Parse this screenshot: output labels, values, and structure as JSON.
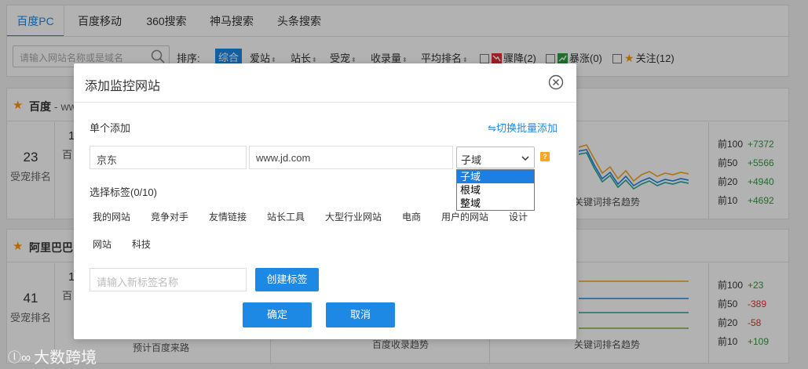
{
  "tabs": [
    {
      "label": "百度PC",
      "active": true
    },
    {
      "label": "百度移动"
    },
    {
      "label": "360搜索"
    },
    {
      "label": "神马搜索"
    },
    {
      "label": "头条搜索"
    }
  ],
  "filter": {
    "search_placeholder": "请输入网站名称或是域名",
    "sort_label": "排序:",
    "sort_items": [
      "综合",
      "爱站",
      "站长",
      "受宠",
      "收录量",
      "平均排名"
    ],
    "check_drop": "骤降(2)",
    "check_rise": "暴涨(0)",
    "check_follow": "关注(12)"
  },
  "cards": [
    {
      "name": "百度",
      "domain_fragment": "- ww",
      "rank": "23",
      "rank_label": "受宠排名",
      "col2_num": "1",
      "col2_txt": "百",
      "chart_caption": "关键词排名趋势",
      "stats": [
        {
          "k": "前100",
          "v": "+7372",
          "dir": "up"
        },
        {
          "k": "前50",
          "v": "+5566",
          "dir": "up"
        },
        {
          "k": "前20",
          "v": "+4940",
          "dir": "up"
        },
        {
          "k": "前10",
          "v": "+4692",
          "dir": "up"
        }
      ]
    },
    {
      "name": "阿里巴巴",
      "rank": "41",
      "rank_label": "受宠排名",
      "col2_num": "1",
      "col2_txt": "百",
      "caption_a": "预计百度来路",
      "caption_b": "百度收录趋势",
      "chart_caption": "关键词排名趋势",
      "stats": [
        {
          "k": "前100",
          "v": "+23",
          "dir": "up"
        },
        {
          "k": "前50",
          "v": "-389",
          "dir": "down"
        },
        {
          "k": "前20",
          "v": "-58",
          "dir": "down"
        },
        {
          "k": "前10",
          "v": "+109",
          "dir": "up"
        }
      ]
    }
  ],
  "modal": {
    "title": "添加监控网站",
    "single_add": "单个添加",
    "switch_link": "⇋切换批量添加",
    "name_value": "京东",
    "domain_value": "www.jd.com",
    "select_value": "子域",
    "select_options": [
      "子域",
      "根域",
      "整域"
    ],
    "tags_label": "选择标签(0/10)",
    "tags": [
      "我的网站",
      "竞争对手",
      "友情链接",
      "站长工具",
      "大型行业网站",
      "电商",
      "用户的网站",
      "设计",
      "网站",
      "科技"
    ],
    "new_tag_placeholder": "请输入新标签名称",
    "create_tag_button": "创建标签",
    "confirm_button": "确定",
    "cancel_button": "取消"
  },
  "watermark": "大数跨境",
  "colors": {
    "accent": "#1e88e5",
    "rise": "#2e9e3e",
    "fall": "#e03030",
    "star": "#ff9800"
  }
}
